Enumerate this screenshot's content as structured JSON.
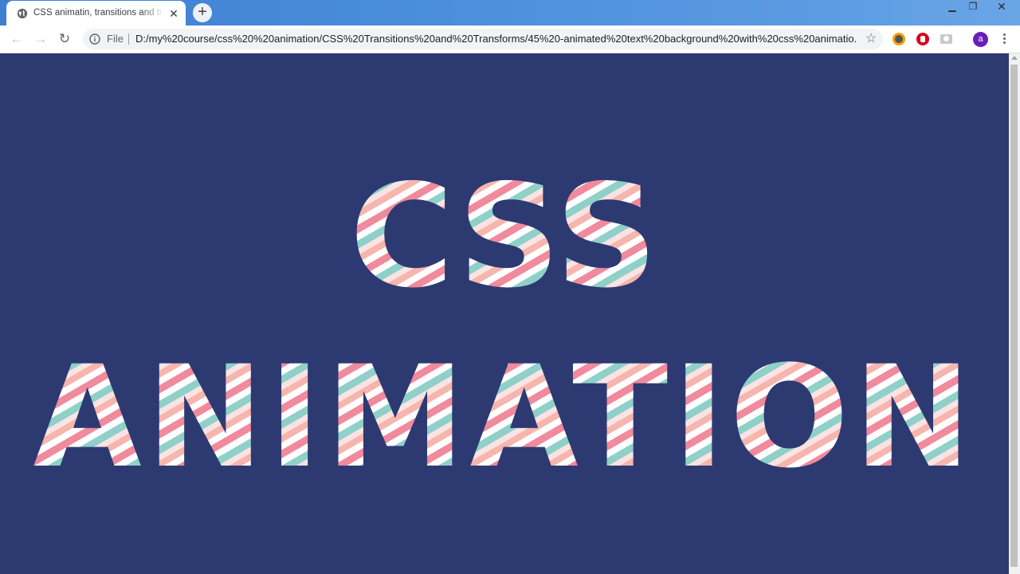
{
  "browser": {
    "tab": {
      "title": "CSS animatin, transitions and transforms",
      "close_glyph": "✕",
      "favicon": "globe-icon"
    },
    "new_tab_glyph": "+",
    "window_controls": {
      "minimize": "▁",
      "maximize": "❐",
      "close": "✕"
    },
    "toolbar": {
      "back_glyph": "←",
      "forward_glyph": "→",
      "reload_glyph": "↻",
      "file_label": "File",
      "url": "D:/my%20course/css%20%20animation/CSS%20Transitions%20and%20Transforms/45%20-animated%20text%20background%20with%20css%20animatio...",
      "star_glyph": "☆",
      "profile_initial": "a",
      "extensions": [
        "extension-icon-1",
        "adblock-icon",
        "camera-icon"
      ]
    }
  },
  "page": {
    "line1": "CSS",
    "line2": "ANIMATION",
    "colors": {
      "background": "#2d3a72",
      "stripe_pink": "#f08a9c",
      "stripe_teal": "#8fd0c9",
      "stripe_peach": "#f6b5ad",
      "stripe_white": "#ffffff"
    }
  }
}
